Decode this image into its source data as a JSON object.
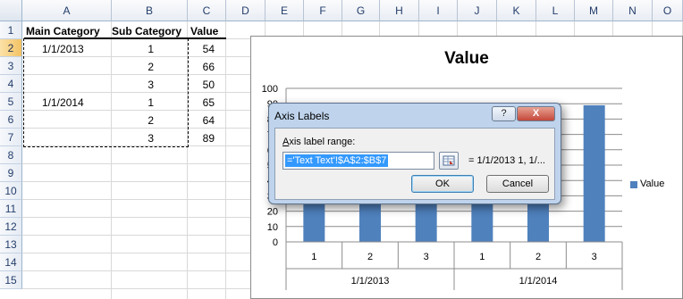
{
  "sheet": {
    "columns": [
      "A",
      "B",
      "C",
      "D",
      "E",
      "F",
      "G",
      "H",
      "I",
      "J",
      "K",
      "L",
      "M",
      "N",
      "O"
    ],
    "rows": [
      "1",
      "2",
      "3",
      "4",
      "5",
      "6",
      "7",
      "8",
      "9",
      "10",
      "11",
      "12",
      "13",
      "14",
      "15"
    ],
    "headers": {
      "main_category": "Main Category",
      "sub_category": "Sub Category",
      "value": "Value"
    },
    "data_rows": [
      {
        "main": "1/1/2013",
        "sub": "1",
        "value": "54"
      },
      {
        "main": "",
        "sub": "2",
        "value": "66"
      },
      {
        "main": "",
        "sub": "3",
        "value": "50"
      },
      {
        "main": "1/1/2014",
        "sub": "1",
        "value": "65"
      },
      {
        "main": "",
        "sub": "2",
        "value": "64"
      },
      {
        "main": "",
        "sub": "3",
        "value": "89"
      }
    ],
    "selected_row": "2"
  },
  "chart_data": {
    "type": "bar",
    "title": "Value",
    "categories": [
      "1",
      "2",
      "3",
      "1",
      "2",
      "3"
    ],
    "groups": [
      {
        "label": "1/1/2013",
        "span": 3
      },
      {
        "label": "1/1/2014",
        "span": 3
      }
    ],
    "series": [
      {
        "name": "Value",
        "values": [
          54,
          66,
          50,
          65,
          64,
          89
        ]
      }
    ],
    "yticks": [
      "0",
      "10",
      "20",
      "30",
      "40",
      "50",
      "60",
      "70",
      "80",
      "90",
      "100"
    ],
    "ylim": [
      0,
      100
    ],
    "bar_color": "#4f81bd",
    "legend_position": "right"
  },
  "dialog": {
    "title": "Axis Labels",
    "help_label": "?",
    "close_label": "X",
    "range_label_accel": "A",
    "range_label_rest": "xis label range:",
    "range_value": "='Text Text'!$A$2:$B$7",
    "range_preview": "= 1/1/2013 1, 1/...",
    "ok_label": "OK",
    "cancel_label": "Cancel"
  }
}
